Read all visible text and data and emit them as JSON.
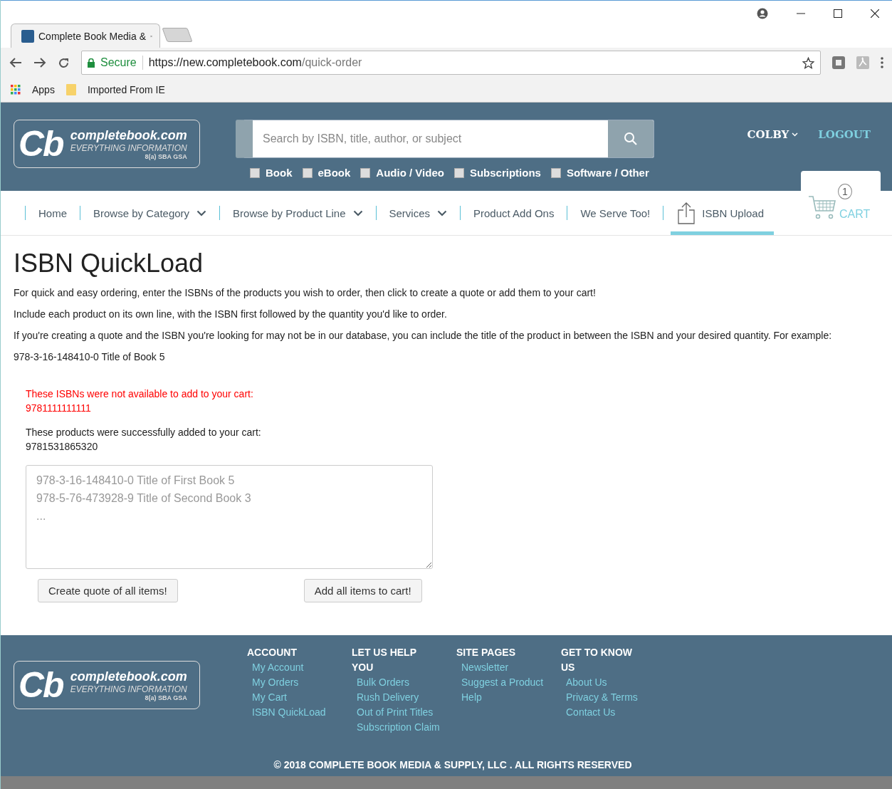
{
  "browser": {
    "tab_title": "Complete Book Media &",
    "secure_label": "Secure",
    "url_host": "https://new.completebook.com",
    "url_path": "/quick-order",
    "bookmarks": [
      {
        "label": "Apps",
        "kind": "apps"
      },
      {
        "label": "Imported From IE",
        "kind": "folder"
      }
    ]
  },
  "header": {
    "logo": {
      "mark": "Cb",
      "name": "completebook.com",
      "tagline": "EVERYTHING INFORMATION",
      "certs": "8(a) SBA GSA"
    },
    "search": {
      "placeholder": "Search by ISBN, title, author, or subject"
    },
    "filters": [
      {
        "label": "Book",
        "checked": false
      },
      {
        "label": "eBook",
        "checked": false
      },
      {
        "label": "Audio / Video",
        "checked": false
      },
      {
        "label": "Subscriptions",
        "checked": false
      },
      {
        "label": "Software / Other",
        "checked": false
      }
    ],
    "user": "COLBY",
    "logout": "LOGOUT",
    "cart": {
      "count": "1",
      "label": "CART"
    }
  },
  "nav": [
    {
      "label": "Home",
      "dropdown": false,
      "selected": false,
      "kind": "link"
    },
    {
      "label": "Browse by Category",
      "dropdown": true,
      "selected": false,
      "kind": "link"
    },
    {
      "label": "Browse by Product Line",
      "dropdown": true,
      "selected": false,
      "kind": "link"
    },
    {
      "label": "Services",
      "dropdown": true,
      "selected": false,
      "kind": "link"
    },
    {
      "label": "Product Add Ons",
      "dropdown": false,
      "selected": false,
      "kind": "link"
    },
    {
      "label": "We Serve Too!",
      "dropdown": false,
      "selected": false,
      "kind": "link"
    },
    {
      "label": "ISBN Upload",
      "dropdown": false,
      "selected": true,
      "kind": "upload"
    }
  ],
  "content": {
    "title": "ISBN QuickLoad",
    "paragraphs": [
      "For quick and easy ordering, enter the ISBNs of the products you wish to order, then click to create a quote or add them to your cart!",
      "Include each product on its own line, with the ISBN first followed by the quantity you'd like to order.",
      "If you're creating a quote and the ISBN you're looking for may not be in our database, you can include the title of the product in between the ISBN and your desired quantity. For example:",
      "978-3-16-148410-0 Title of Book 5"
    ],
    "messages": [
      {
        "kind": "error",
        "heading": "These ISBNs were not available to add to your cart:",
        "items": [
          "9781111111111"
        ]
      },
      {
        "kind": "success",
        "heading": "These products were successfully added to your cart:",
        "items": [
          "9781531865320"
        ]
      }
    ],
    "textarea": {
      "placeholder": "978-3-16-148410-0 Title of First Book 5\n978-5-76-473928-9 Title of Second Book 3\n..."
    },
    "buttons": [
      "Create quote of all items!",
      "Add all items to cart!"
    ]
  },
  "footer": {
    "logo": {
      "mark": "Cb",
      "name": "completebook.com",
      "tagline": "EVERYTHING INFORMATION",
      "certs": "8(a) SBA GSA"
    },
    "columns": [
      {
        "heading": "ACCOUNT",
        "links": [
          "My Account",
          "My Orders",
          "My Cart",
          "ISBN QuickLoad"
        ]
      },
      {
        "heading": "LET US HELP YOU",
        "links": [
          "Bulk Orders",
          "Rush Delivery",
          "Out of Print Titles",
          "Subscription Claim"
        ]
      },
      {
        "heading": "SITE PAGES",
        "links": [
          "Newsletter",
          "Suggest a Product",
          "Help"
        ]
      },
      {
        "heading": "GET TO KNOW US",
        "links": [
          "About Us",
          "Privacy & Terms",
          "Contact Us"
        ]
      }
    ],
    "copyright": "© 2018 COMPLETE BOOK MEDIA & SUPPLY, LLC . ALL RIGHTS RESERVED"
  }
}
